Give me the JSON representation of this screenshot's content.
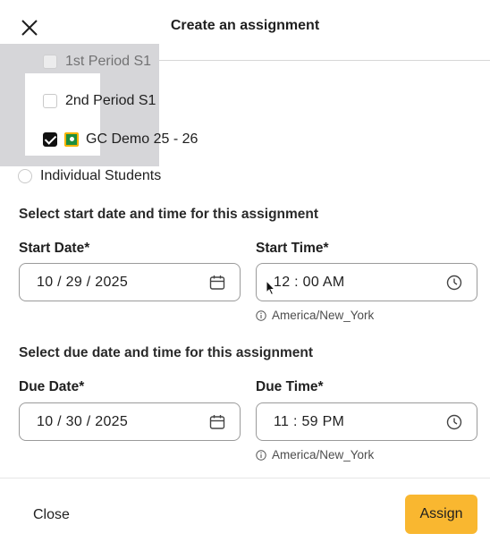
{
  "header": {
    "title": "Create an assignment"
  },
  "assign_to": {
    "periods": [
      {
        "label": "1st Period S1",
        "checked": false
      },
      {
        "label": "2nd Period S1",
        "checked": false
      },
      {
        "label": "GC Demo 25 - 26",
        "checked": true,
        "icon": "google-classroom-icon"
      }
    ],
    "individual_label": "Individual Students"
  },
  "start": {
    "section_title": "Select start date and time for this assignment",
    "date_label": "Start Date",
    "required_mark": "*",
    "date_value": "10 / 29 / 2025",
    "time_label": "Start Time",
    "time_value": "12 : 00   AM",
    "timezone": "America/New_York"
  },
  "due": {
    "section_title": "Select due date and time for this assignment",
    "date_label": "Due Date",
    "required_mark": "*",
    "date_value": "10 / 30 / 2025",
    "time_label": "Due Time",
    "time_value": "11 : 59   PM",
    "timezone": "America/New_York"
  },
  "footer": {
    "close_label": "Close",
    "assign_label": "Assign"
  },
  "colors": {
    "assign_button": "#f9b730",
    "overlay": "#d6d6d9",
    "checkbox_checked": "#111111"
  }
}
